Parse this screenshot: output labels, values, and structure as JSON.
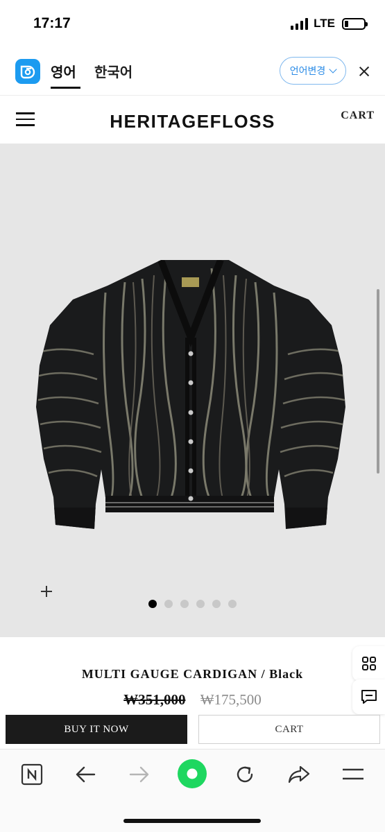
{
  "status_bar": {
    "time": "17:17",
    "network": "LTE",
    "battery_level": 0.2
  },
  "translate_bar": {
    "logo_icon": "papago-icon",
    "tabs": [
      {
        "label": "영어",
        "active": true
      },
      {
        "label": "한국어",
        "active": false
      }
    ],
    "change_language_label": "언어변경",
    "close_icon": "close-icon",
    "accent_color": "#2a8be6"
  },
  "header": {
    "menu_icon": "hamburger-icon",
    "brand": "HERITAGEFLOSS",
    "cart_label": "CART"
  },
  "gallery": {
    "image_description_icon": "cardigan-photo",
    "total_slides": 6,
    "active_slide": 1,
    "zoom_icon": "plus-icon"
  },
  "product": {
    "title": "MULTI GAUGE CARDIGAN / Black",
    "original_price": "₩351,000",
    "sale_price": "₩175,500",
    "buy_now_label": "BUY IT NOW",
    "add_to_cart_label": "CART"
  },
  "side_buttons": [
    {
      "icon": "grid-icon"
    },
    {
      "icon": "chat-icon"
    }
  ],
  "browser_toolbar": [
    {
      "icon": "naver-n-icon"
    },
    {
      "icon": "back-arrow-icon"
    },
    {
      "icon": "forward-arrow-icon"
    },
    {
      "icon": "green-dot-icon"
    },
    {
      "icon": "refresh-icon"
    },
    {
      "icon": "share-icon"
    },
    {
      "icon": "menu-lines-icon"
    }
  ],
  "colors": {
    "sale_price": "#8a8a8a",
    "buy_button": "#1b1b1b",
    "green_button": "#1ed760"
  }
}
